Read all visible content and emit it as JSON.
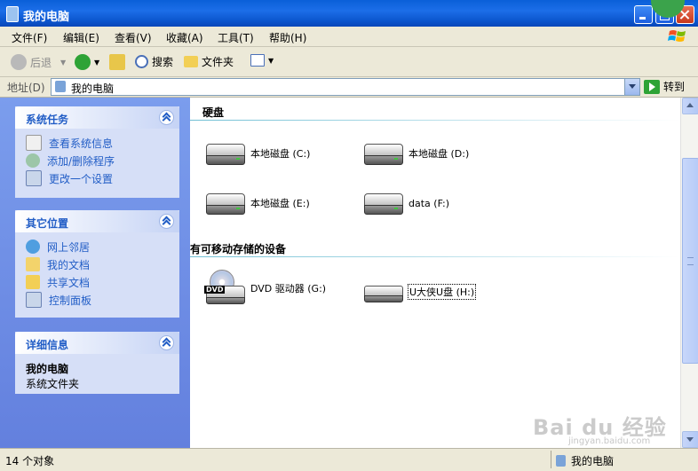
{
  "window": {
    "title": "我的电脑"
  },
  "menu": [
    "文件(F)",
    "编辑(E)",
    "查看(V)",
    "收藏(A)",
    "工具(T)",
    "帮助(H)"
  ],
  "toolbar": {
    "back": "后退",
    "search": "搜索",
    "folders": "文件夹"
  },
  "address": {
    "label": "地址(D)",
    "value": "我的电脑",
    "go": "转到"
  },
  "sidebar": {
    "system_tasks": {
      "title": "系统任务",
      "items": [
        "查看系统信息",
        "添加/删除程序",
        "更改一个设置"
      ]
    },
    "other_places": {
      "title": "其它位置",
      "items": [
        "网上邻居",
        "我的文档",
        "共享文档",
        "控制面板"
      ]
    },
    "details": {
      "title": "详细信息",
      "name": "我的电脑",
      "type": "系统文件夹"
    }
  },
  "groups": {
    "hard_disks": {
      "title": "硬盘",
      "items": [
        "本地磁盘 (C:)",
        "本地磁盘 (D:)",
        "本地磁盘 (E:)",
        "data (F:)"
      ]
    },
    "removable": {
      "title": "有可移动存储的设备",
      "items": [
        "DVD 驱动器 (G:)",
        "U大侠U盘 (H:)"
      ]
    }
  },
  "status": {
    "count": "14 个对象",
    "location": "我的电脑"
  },
  "watermark": {
    "brand": "Bai du 经验",
    "url": "jingyan.baidu.com"
  },
  "icons": {
    "dvd_tag": "DVD"
  },
  "colors": {
    "title_bar": "#0a5fd8",
    "link": "#215dc6",
    "sidebar": "#6f8fe5"
  }
}
